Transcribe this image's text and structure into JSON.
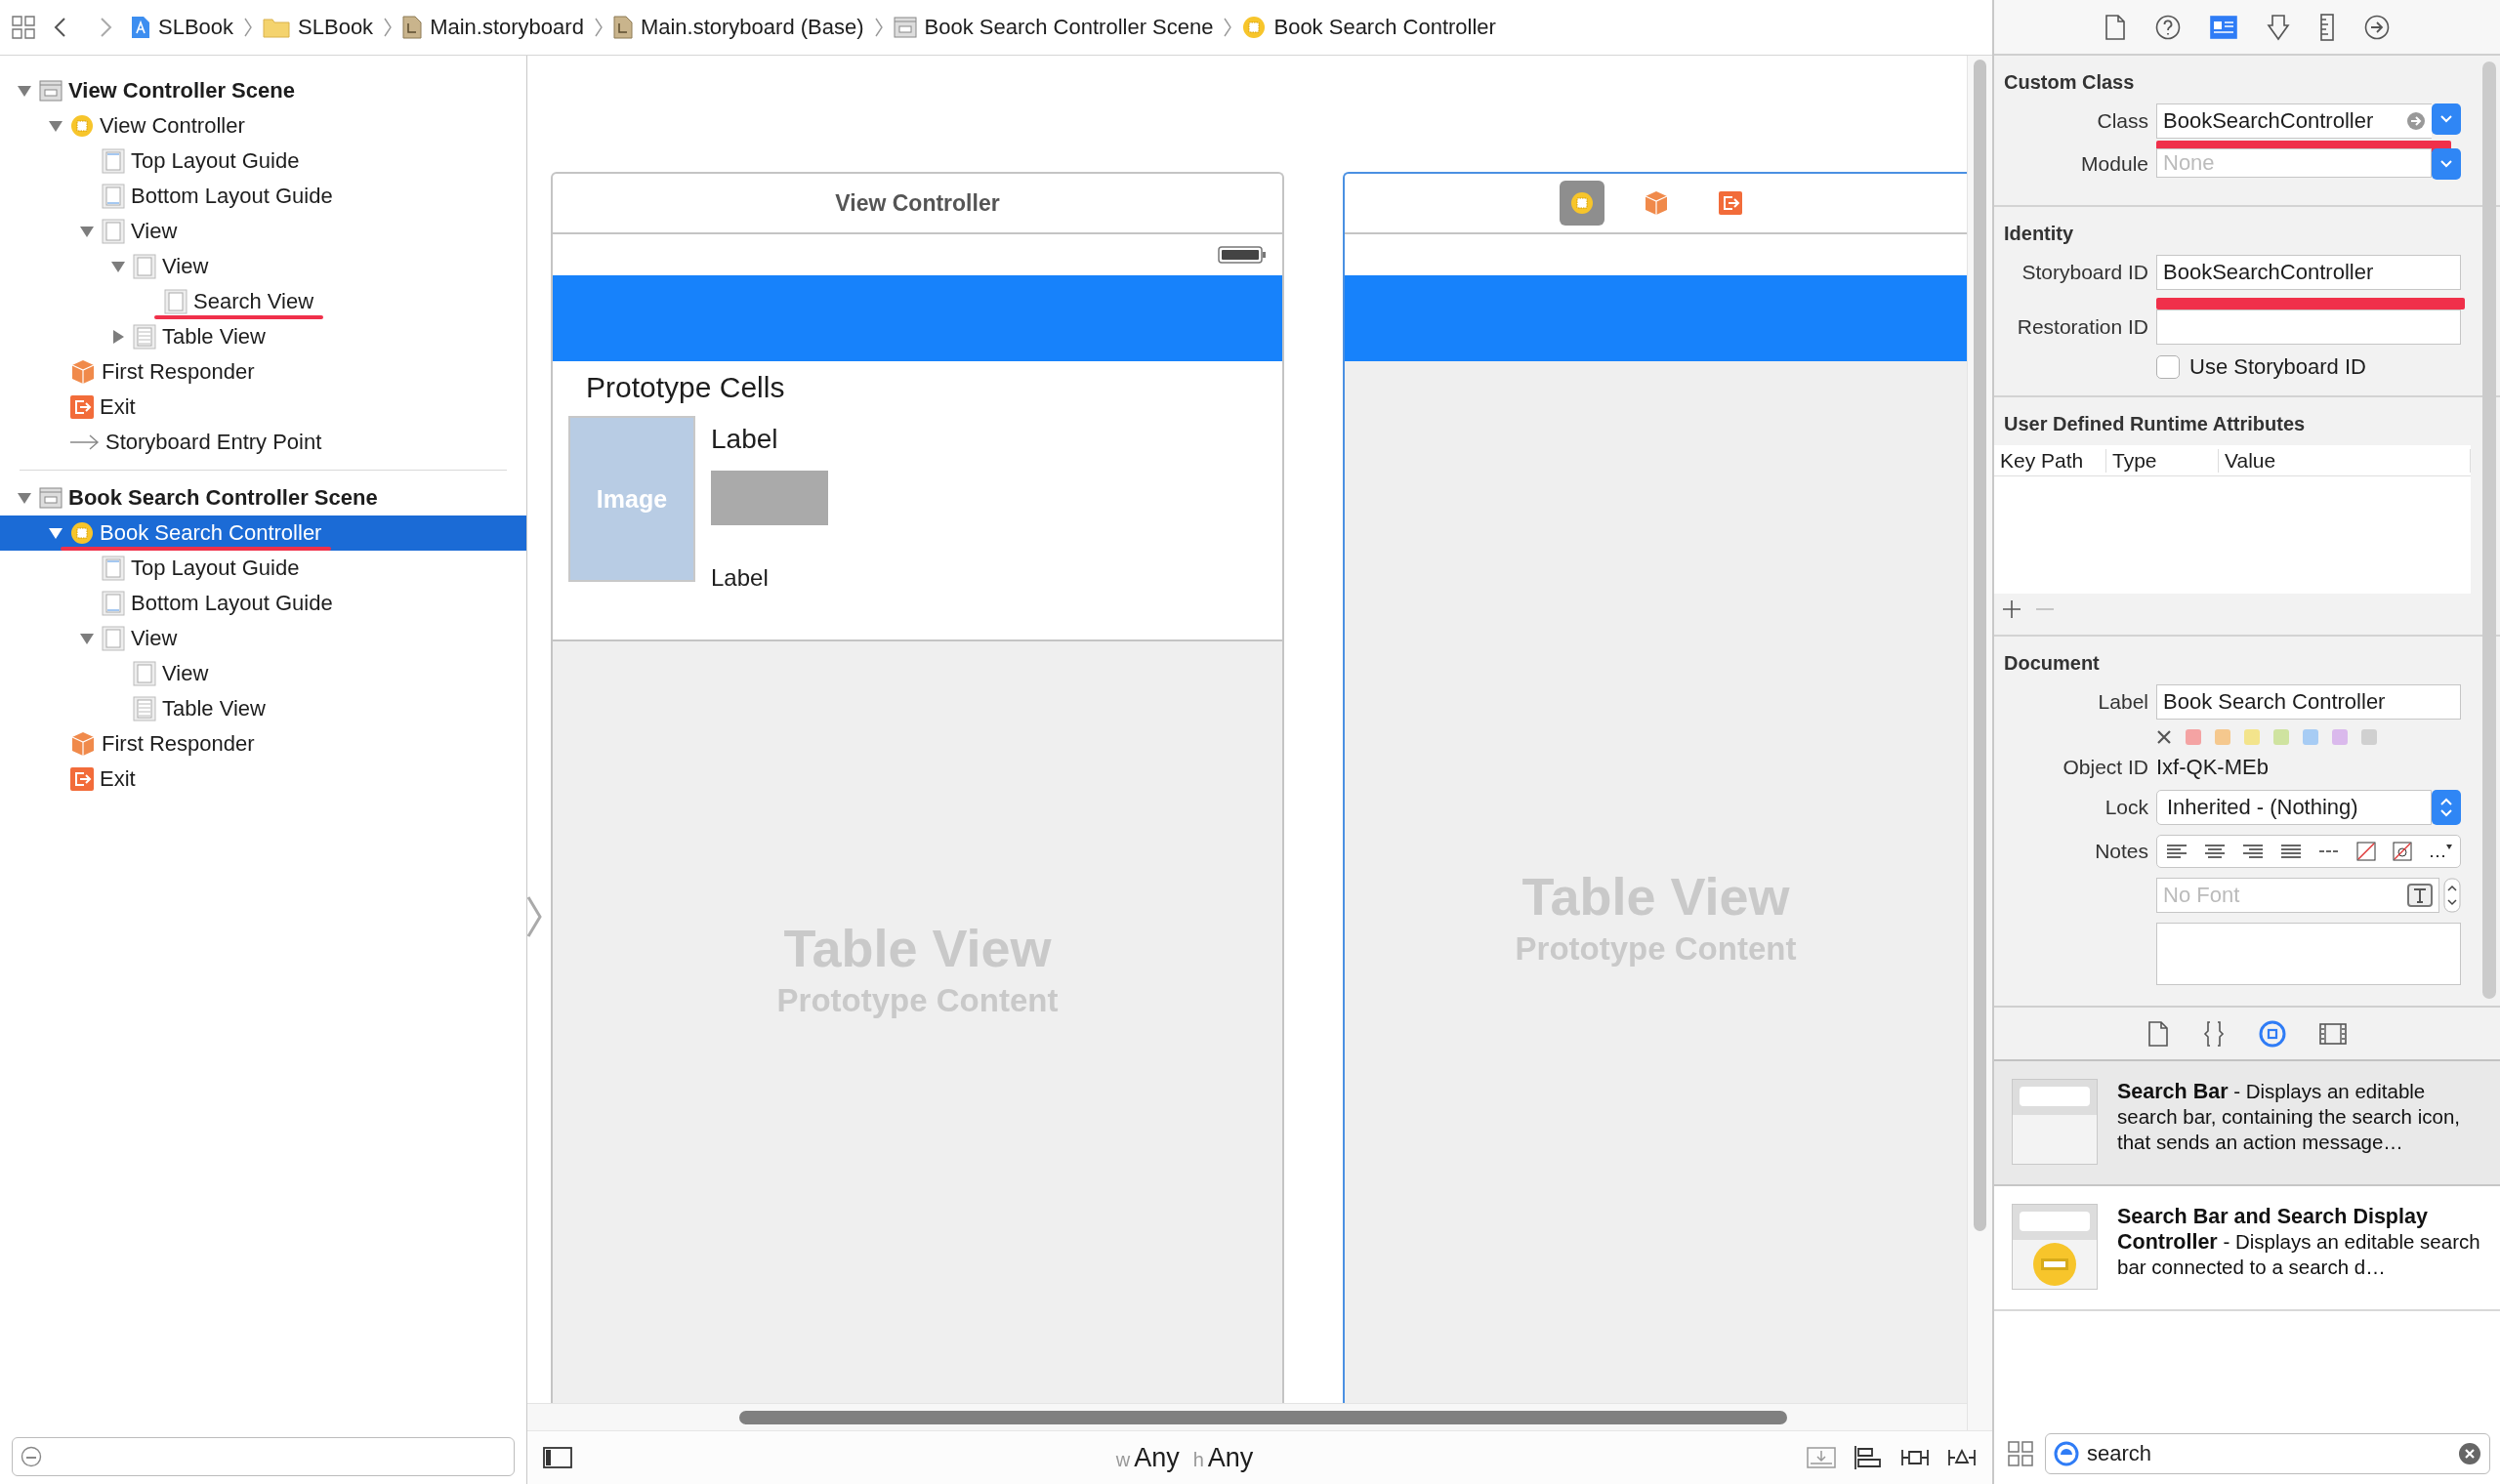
{
  "breadcrumbs": [
    {
      "kind": "project",
      "label": "SLBook"
    },
    {
      "kind": "folder",
      "label": "SLBook"
    },
    {
      "kind": "storyboard",
      "label": "Main.storyboard"
    },
    {
      "kind": "storyboard",
      "label": "Main.storyboard (Base)"
    },
    {
      "kind": "scene",
      "label": "Book Search Controller Scene"
    },
    {
      "kind": "controller",
      "label": "Book Search Controller"
    }
  ],
  "outline": [
    {
      "label": "View Controller Scene",
      "kind": "scene",
      "expanded": true,
      "selected": false,
      "underlined": false,
      "children": [
        {
          "label": "View Controller",
          "kind": "controller",
          "expanded": true,
          "selected": false,
          "underlined": false,
          "children": [
            {
              "label": "Top Layout Guide",
              "kind": "guide-top",
              "selected": false,
              "underlined": false
            },
            {
              "label": "Bottom Layout Guide",
              "kind": "guide-bottom",
              "selected": false,
              "underlined": false
            },
            {
              "label": "View",
              "kind": "view",
              "expanded": true,
              "selected": false,
              "underlined": false,
              "children": [
                {
                  "label": "View",
                  "kind": "view",
                  "expanded": true,
                  "selected": false,
                  "underlined": false,
                  "children": [
                    {
                      "label": "Search View",
                      "kind": "view",
                      "selected": false,
                      "underlined": true
                    }
                  ]
                },
                {
                  "label": "Table View",
                  "kind": "table",
                  "expanded": false,
                  "selected": false,
                  "underlined": false
                }
              ]
            }
          ]
        },
        {
          "label": "First Responder",
          "kind": "responder",
          "selected": false,
          "underlined": false
        },
        {
          "label": "Exit",
          "kind": "exit",
          "selected": false,
          "underlined": false
        },
        {
          "label": "Storyboard Entry Point",
          "kind": "entry",
          "selected": false,
          "underlined": false
        }
      ]
    },
    {
      "label": "Book Search Controller Scene",
      "kind": "scene",
      "expanded": true,
      "selected": false,
      "underlined": false,
      "children": [
        {
          "label": "Book Search Controller",
          "kind": "controller",
          "expanded": true,
          "selected": true,
          "underlined": true,
          "children": [
            {
              "label": "Top Layout Guide",
              "kind": "guide-top",
              "selected": false,
              "underlined": false
            },
            {
              "label": "Bottom Layout Guide",
              "kind": "guide-bottom",
              "selected": false,
              "underlined": false
            },
            {
              "label": "View",
              "kind": "view",
              "expanded": true,
              "selected": false,
              "underlined": false,
              "children": [
                {
                  "label": "View",
                  "kind": "view",
                  "selected": false,
                  "underlined": false
                },
                {
                  "label": "Table View",
                  "kind": "table",
                  "selected": false,
                  "underlined": false
                }
              ]
            }
          ]
        },
        {
          "label": "First Responder",
          "kind": "responder",
          "selected": false,
          "underlined": false
        },
        {
          "label": "Exit",
          "kind": "exit",
          "selected": false,
          "underlined": false
        }
      ]
    }
  ],
  "canvas": {
    "scenes": [
      {
        "title": "View Controller",
        "selected": false,
        "section": "Prototype Cells",
        "image_label": "Image",
        "cell_labels": [
          "Label",
          "Label"
        ],
        "placeholder_title": "Table View",
        "placeholder_subtitle": "Prototype Content"
      },
      {
        "selected": true,
        "dock": [
          {
            "kind": "controller",
            "selected": true
          },
          {
            "kind": "responder",
            "selected": false
          },
          {
            "kind": "exit",
            "selected": false
          }
        ],
        "placeholder_title": "Table View",
        "placeholder_subtitle": "Prototype Content"
      }
    ]
  },
  "size_class": {
    "width_prefix": "w",
    "width_value": "Any",
    "height_prefix": "h",
    "height_value": "Any"
  },
  "inspector": {
    "tabs": [
      {
        "kind": "file",
        "selected": false
      },
      {
        "kind": "help",
        "selected": false
      },
      {
        "kind": "identity",
        "selected": true
      },
      {
        "kind": "attributes",
        "selected": false
      },
      {
        "kind": "size",
        "selected": false
      },
      {
        "kind": "connections",
        "selected": false
      }
    ],
    "custom_class": {
      "title": "Custom Class",
      "class_label": "Class",
      "class_value": "BookSearchController",
      "class_underlined": true,
      "module_label": "Module",
      "module_placeholder": "None"
    },
    "identity": {
      "title": "Identity",
      "storyboard_label": "Storyboard ID",
      "storyboard_value": "BookSearchController",
      "storyboard_underlined": true,
      "restoration_label": "Restoration ID",
      "use_storyboard_label": "Use Storyboard ID",
      "use_storyboard_checked": false
    },
    "runtime_attributes": {
      "title": "User Defined Runtime Attributes",
      "columns": [
        "Key Path",
        "Type",
        "Value"
      ]
    },
    "document": {
      "title": "Document",
      "label_label": "Label",
      "label_value": "Book Search Controller",
      "colors": [
        {
          "color": "#f4a3a3"
        },
        {
          "color": "#f5c88e"
        },
        {
          "color": "#f3e48c"
        },
        {
          "color": "#cfe3a0"
        },
        {
          "color": "#a7ccf4"
        },
        {
          "color": "#dab9ec"
        },
        {
          "color": "#d0d0d0"
        }
      ],
      "object_id_label": "Object ID",
      "object_id": "Ixf-QK-MEb",
      "lock_label": "Lock",
      "lock_value": "Inherited - (Nothing)",
      "notes_label": "Notes",
      "font_placeholder": "No Font"
    }
  },
  "library": {
    "tabs": [
      {
        "kind": "file",
        "selected": false
      },
      {
        "kind": "code",
        "selected": false
      },
      {
        "kind": "object",
        "selected": true
      },
      {
        "kind": "media",
        "selected": false
      }
    ],
    "items": [
      {
        "kind": "search-bar",
        "selected": true,
        "text": "**Search Bar** - Displays an editable search bar, containing the search icon, that sends an action message…"
      },
      {
        "kind": "search-display",
        "selected": false,
        "text": "**Search Bar and Search Display Controller** - Displays an editable search bar connected to a search d…"
      }
    ],
    "search": {
      "value": "search"
    }
  }
}
